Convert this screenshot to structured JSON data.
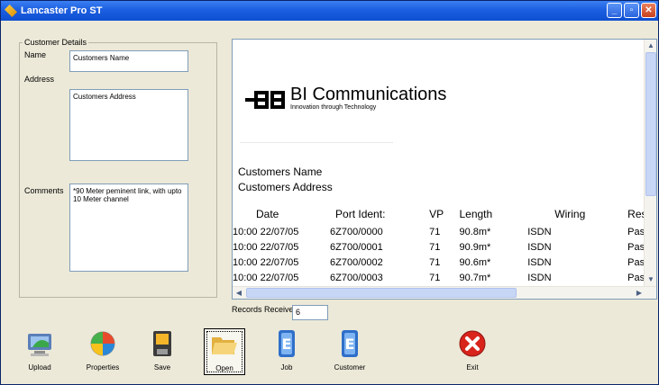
{
  "window": {
    "title": "Lancaster Pro ST",
    "buttons": [
      "minimize",
      "maximize",
      "close"
    ],
    "colors": {
      "titlebar": "#1c5fe0",
      "background": "#ece9d8",
      "close": "#c9411c"
    }
  },
  "customer_details": {
    "group_label": "Customer Details",
    "name_label": "Name",
    "name_value": "Customers Name",
    "address_label": "Address",
    "address_value": "Customers Address",
    "comments_label": "Comments",
    "comments_value": "*90 Meter peminent link, with upto 10 Meter channel"
  },
  "report": {
    "brand_name": "BI Communications",
    "brand_tagline": "Innovation through Technology",
    "customer_name": "Customers Name",
    "customer_address": "Customers Address",
    "columns": [
      "Date",
      "Port Ident:",
      "VP",
      "Length",
      "Wiring",
      "Resu"
    ],
    "rows": [
      [
        "10:00 22/07/05",
        "6Z700/0000",
        "71",
        "90.8m*",
        "ISDN",
        "Pass"
      ],
      [
        "10:00 22/07/05",
        "6Z700/0001",
        "71",
        "90.9m*",
        "ISDN",
        "Pass"
      ],
      [
        "10:00 22/07/05",
        "6Z700/0002",
        "71",
        "90.6m*",
        "ISDN",
        "Pass"
      ],
      [
        "10:00 22/07/05",
        "6Z700/0003",
        "71",
        "90.7m*",
        "ISDN",
        "Pass"
      ]
    ]
  },
  "records": {
    "label": "Records Received",
    "value": "6"
  },
  "toolbar": {
    "upload": "Upload",
    "properties": "Properties",
    "save": "Save",
    "open": "Open",
    "job": "Job",
    "customer": "Customer",
    "exit": "Exit"
  },
  "icons": {
    "upload": "computer-upload-icon",
    "properties": "properties-icon",
    "save": "save-icon",
    "open": "folder-open-icon",
    "job": "job-icon",
    "customer": "customer-icon",
    "exit": "exit-icon"
  }
}
